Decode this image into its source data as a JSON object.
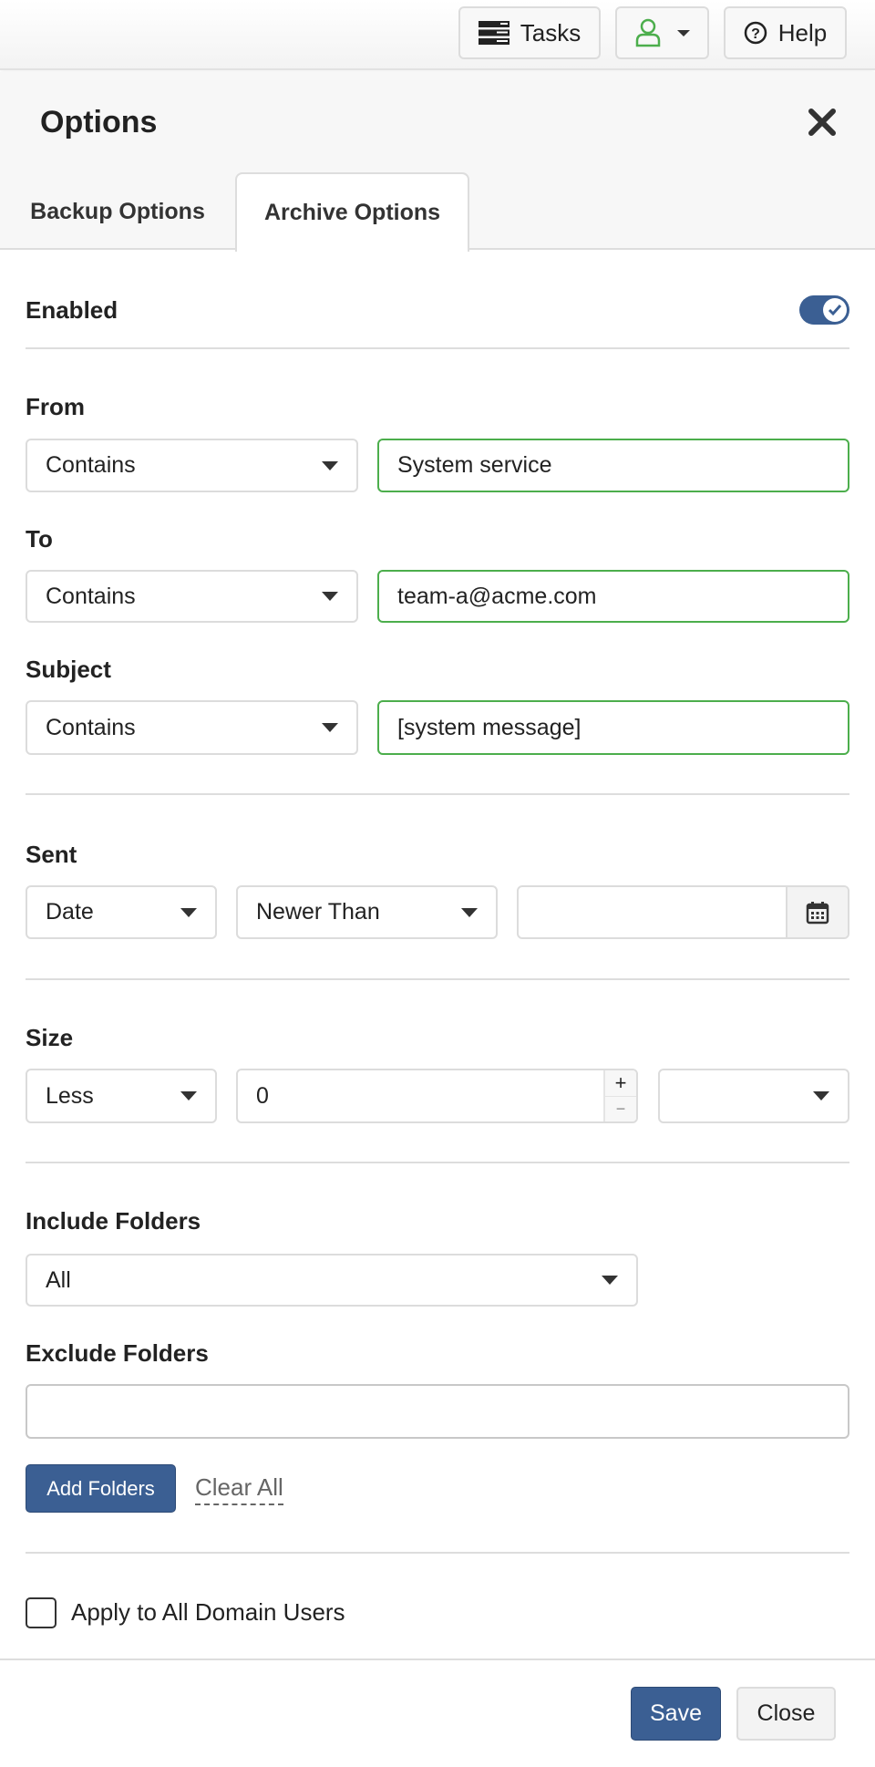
{
  "topbar": {
    "tasks_label": "Tasks",
    "help_label": "Help"
  },
  "dialog": {
    "title": "Options",
    "tabs": [
      {
        "label": "Backup Options",
        "active": false
      },
      {
        "label": "Archive Options",
        "active": true
      }
    ]
  },
  "form": {
    "enabled": {
      "label": "Enabled",
      "value": true
    },
    "from": {
      "label": "From",
      "operator": "Contains",
      "value": "System service"
    },
    "to": {
      "label": "To",
      "operator": "Contains",
      "value": "team-a@acme.com"
    },
    "subject": {
      "label": "Subject",
      "operator": "Contains",
      "value": "[system message]"
    },
    "sent": {
      "label": "Sent",
      "type": "Date",
      "comparison": "Newer Than",
      "date": ""
    },
    "size": {
      "label": "Size",
      "comparison": "Less",
      "value": "0",
      "unit": "",
      "plus": "+",
      "minus": "−"
    },
    "include_folders": {
      "label": "Include Folders",
      "value": "All"
    },
    "exclude_folders": {
      "label": "Exclude Folders",
      "value": ""
    },
    "add_folders_label": "Add Folders",
    "clear_all_label": "Clear All",
    "apply_all": {
      "label": "Apply to All Domain Users",
      "checked": false
    }
  },
  "footer": {
    "save_label": "Save",
    "close_label": "Close"
  },
  "colors": {
    "primary": "#3b5f93",
    "valid_border": "#4cae4c",
    "user_icon": "#4cae4c"
  }
}
